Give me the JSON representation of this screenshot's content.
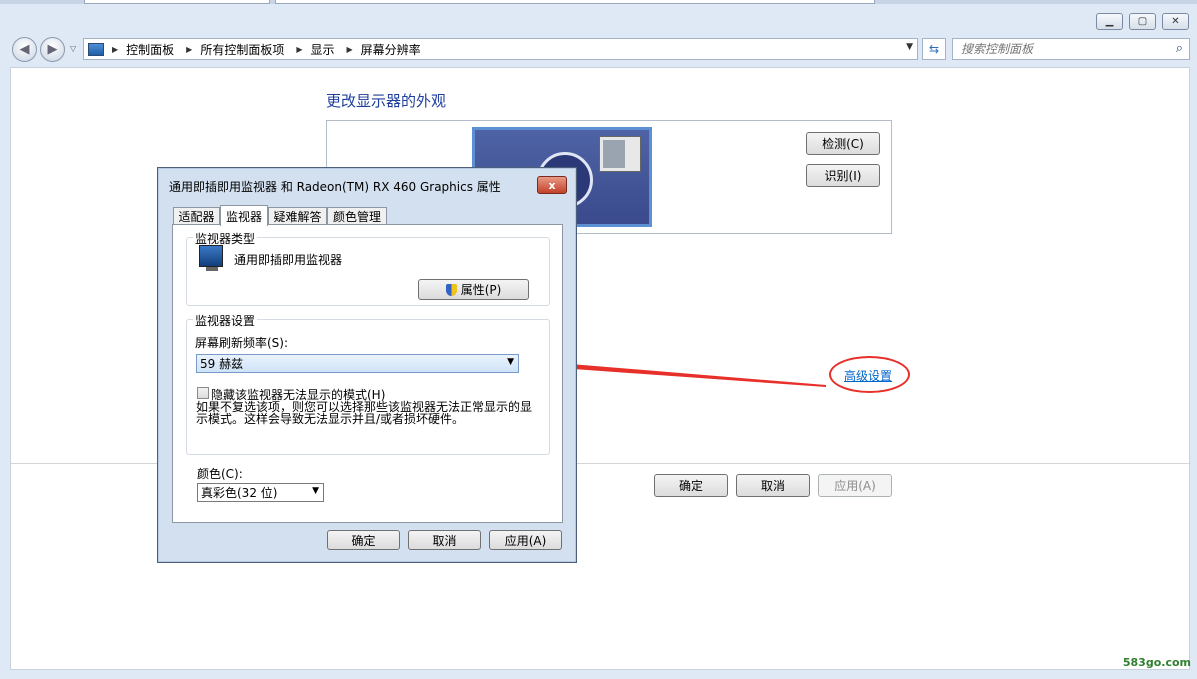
{
  "breadcrumb": [
    "控制面板",
    "所有控制面板项",
    "显示",
    "屏幕分辨率"
  ],
  "search": {
    "placeholder": "搜索控制面板"
  },
  "main": {
    "heading": "更改显示器的外观",
    "detect_label": "检测(C)",
    "identify_label": "识别(I)",
    "advanced_link": "高级设置",
    "ok_label": "确定",
    "cancel_label": "取消",
    "apply_label": "应用(A)"
  },
  "dialog": {
    "title": "通用即插即用监视器 和 Radeon(TM) RX 460 Graphics 属性",
    "close_label": "x",
    "tabs": [
      "适配器",
      "监视器",
      "疑难解答",
      "颜色管理"
    ],
    "active_tab": "监视器",
    "monitor_type_legend": "监视器类型",
    "monitor_name": "通用即插即用监视器",
    "properties_label": "属性(P)",
    "monitor_settings_legend": "监视器设置",
    "refresh_label": "屏幕刷新频率(S):",
    "refresh_value": "59 赫兹",
    "hide_modes_label": "隐藏该监视器无法显示的模式(H)",
    "hide_modes_checked": false,
    "hide_modes_desc": "如果不复选该项，则您可以选择那些该监视器无法正常显示的显示模式。这样会导致无法显示并且/或者损坏硬件。",
    "color_label": "颜色(C):",
    "color_value": "真彩色(32 位)",
    "ok_label": "确定",
    "cancel_label": "取消",
    "apply_label": "应用(A)"
  },
  "watermark": "583go.com",
  "colors": {
    "annotation_red": "#e8302a",
    "link_blue": "#0066cc",
    "heading_blue": "#1f3f9d"
  }
}
